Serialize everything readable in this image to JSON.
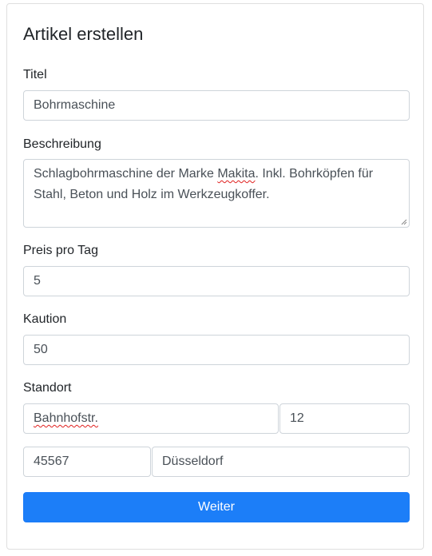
{
  "form": {
    "title": "Artikel erstellen",
    "title_field": {
      "label": "Titel",
      "value": "Bohrmaschine"
    },
    "description": {
      "label": "Beschreibung",
      "value_part1": "Schlagbohrmaschine der Marke ",
      "value_misspelled": "Makita",
      "value_part2": ". Inkl. Bohrköpfen für Stahl, Beton und Holz im Werkzeugkoffer."
    },
    "price_per_day": {
      "label": "Preis pro Tag",
      "value": "5"
    },
    "deposit": {
      "label": "Kaution",
      "value": "50"
    },
    "location": {
      "label": "Standort",
      "street": "Bahnhofstr.",
      "house_number": "12",
      "postal_code": "45567",
      "city": "Düsseldorf"
    },
    "submit_label": "Weiter"
  },
  "colors": {
    "primary": "#1c7ef8",
    "border": "#ced4da",
    "spellcheck": "#e0201e"
  }
}
